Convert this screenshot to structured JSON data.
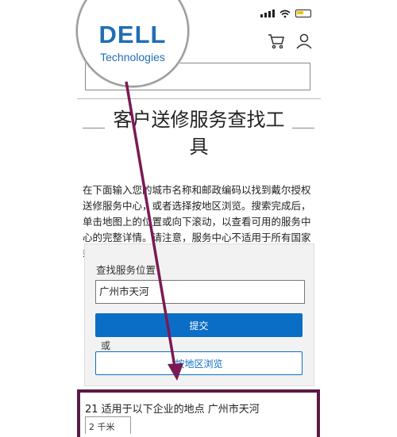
{
  "brand": {
    "logo_text": "DELL",
    "logo_sub": "Technologies",
    "color": "#1f6eb6"
  },
  "header": {
    "search_value": ""
  },
  "page": {
    "title": "客户送修服务查找工具",
    "description": "在下面输入您的城市名称和邮政编码以找到戴尔授权送修服务中心，或者选择按地区浏览。搜索完成后，单击地图上的位置或向下滚动，以查看可用的服务中心的完整详情。请注意，服务中心不适用于所有国家或地区。"
  },
  "finder": {
    "label": "查找服务位置",
    "location_value": "广州市天河",
    "submit_label": "提交",
    "or_text": "或",
    "browse_label": "按地区浏览"
  },
  "results": {
    "summary": "21 适用于以下企业的地点 广州市天河",
    "chip_text": "2 千米"
  },
  "colors": {
    "accent": "#0b6ec6",
    "annotation": "#7a1a55"
  }
}
